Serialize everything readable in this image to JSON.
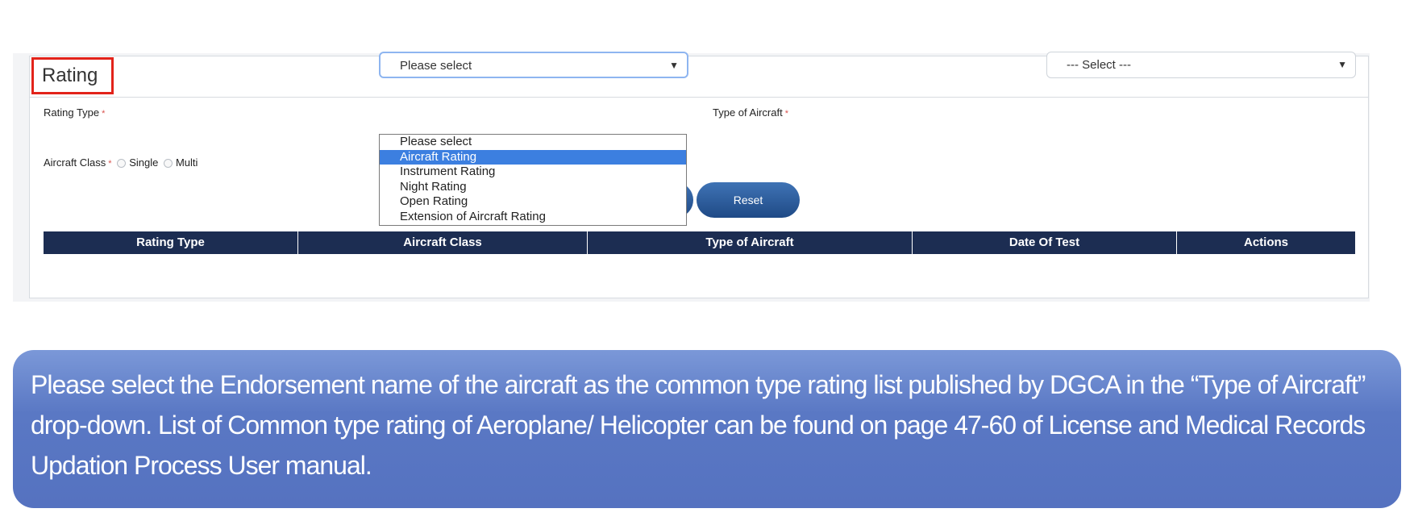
{
  "form": {
    "title": "Rating",
    "rating_type_label": "Rating Type",
    "type_of_aircraft_label": "Type of Aircraft",
    "required_marker": "*",
    "aircraft_class_label": "Aircraft Class",
    "radio_single": "Single",
    "radio_multi": "Multi",
    "rating_type_value": "Please select",
    "type_of_aircraft_value": "--- Select ---",
    "reset_label": "Reset"
  },
  "dropdown": {
    "options": [
      "Please select",
      "Aircraft Rating",
      "Instrument Rating",
      "Night Rating",
      "Open Rating",
      "Extension of Aircraft Rating"
    ],
    "highlighted_index": 1
  },
  "table": {
    "headers": [
      "Rating Type",
      "Aircraft Class",
      "Type of Aircraft",
      "Date Of Test",
      "Actions"
    ]
  },
  "note": {
    "text": "Please select the Endorsement name of the aircraft as the common type rating list published by DGCA in the “Type of Aircraft” drop-down. List of Common type rating of Aeroplane/ Helicopter can be found on page 47-60 of License and Medical Records Updation Process User manual."
  },
  "colors": {
    "header_bar": "#1c2d52",
    "accent_button": "#2b5c9c",
    "highlight": "#3c7fe0",
    "annotation_border": "#e2231a",
    "note_background": "#5a78c4"
  },
  "icons": {
    "select_arrow": "caret-down-icon"
  }
}
